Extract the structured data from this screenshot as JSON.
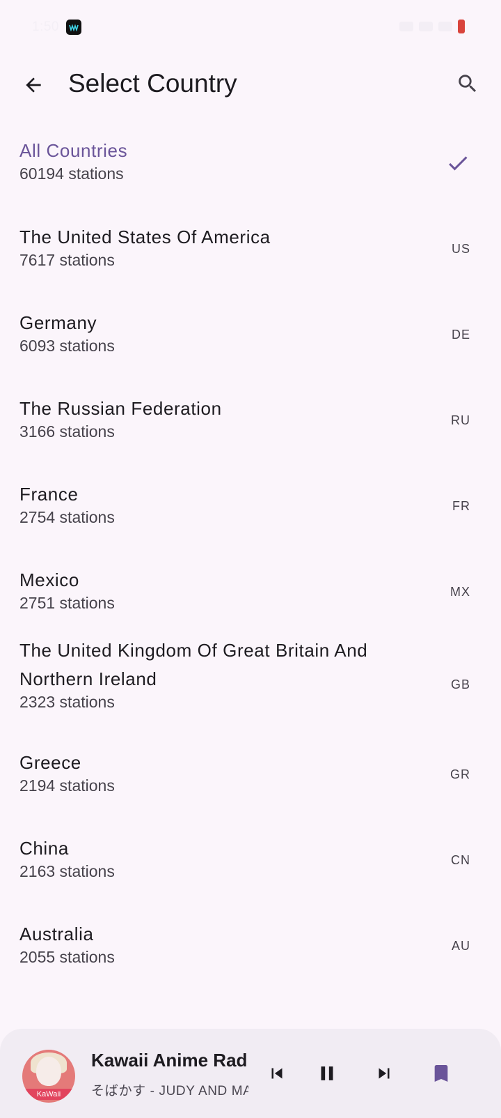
{
  "status_bar": {
    "time": "1:50"
  },
  "top_bar": {
    "title": "Select Country"
  },
  "countries": [
    {
      "name": "All Countries",
      "count": "60194 stations",
      "code": "",
      "selected": true
    },
    {
      "name": "The United States Of America",
      "count": "7617 stations",
      "code": "US"
    },
    {
      "name": "Germany",
      "count": "6093 stations",
      "code": "DE"
    },
    {
      "name": "The Russian Federation",
      "count": "3166 stations",
      "code": "RU"
    },
    {
      "name": "France",
      "count": "2754 stations",
      "code": "FR"
    },
    {
      "name": "Mexico",
      "count": "2751 stations",
      "code": "MX"
    },
    {
      "name": "The United Kingdom Of Great Britain And",
      "name_line2": "Northern Ireland",
      "count": "2323 stations",
      "code": "GB"
    },
    {
      "name": "Greece",
      "count": "2194 stations",
      "code": "GR"
    },
    {
      "name": "China",
      "count": "2163 stations",
      "code": "CN"
    },
    {
      "name": "Australia",
      "count": "2055 stations",
      "code": "AU"
    }
  ],
  "player": {
    "title": "Kawaii Anime Radio",
    "subtitle": "そばかす - JUDY AND MARY",
    "art_label": "KaWaii"
  },
  "colors": {
    "accent": "#6a5499",
    "background": "#fbf5fb",
    "player_bg": "#f1ecf3"
  }
}
